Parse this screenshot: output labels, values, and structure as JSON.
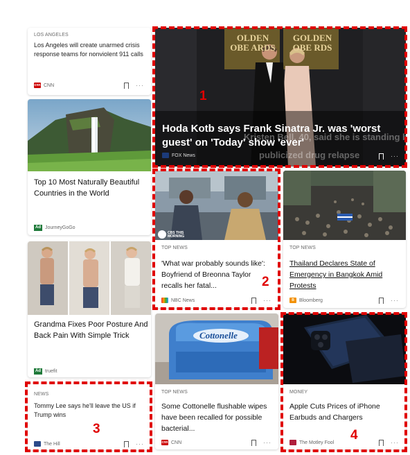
{
  "cards": {
    "la": {
      "category": "LOS ANGELES",
      "title": "Los Angeles will create unarmed crisis response teams for nonviolent 911 calls",
      "source": "CNN"
    },
    "countries": {
      "title": "Top 10 Most Naturally Beautiful Countries in the World",
      "ad_label": "Ad",
      "source": "JourneyGoGo"
    },
    "hero": {
      "title": "Hoda Kotb says Frank Sinatra Jr. was 'worst guest' on 'Today' show 'ever'",
      "source": "FOX News",
      "bg_text_1": "Kristen Bell, 40, said she is standing by",
      "bg_text_2": "publicized drug relapse",
      "sign_left": "OLDEN OBE ARDS",
      "sign_right": "GOLDEN OBE RDS"
    },
    "breonna": {
      "category": "TOP NEWS",
      "title": "'What war probably sounds like': Boyfriend of Breonna Taylor recalls her fatal...",
      "source": "NBC News",
      "tv_logo": "CBS THIS MORNING"
    },
    "thailand": {
      "category": "TOP NEWS",
      "title": "Thailand Declares State of Emergency in Bangkok Amid Protests",
      "source": "Bloomberg"
    },
    "grandma": {
      "title": "Grandma Fixes Poor Posture And Back Pain With Simple Trick",
      "ad_label": "Ad",
      "source": "truefit"
    },
    "cottonelle": {
      "category": "TOP NEWS",
      "title": "Some Cottonelle flushable wipes have been recalled for possible bacterial...",
      "source": "CNN",
      "brand": "Cottonelle"
    },
    "tommy": {
      "category": "NEWS",
      "title": "Tommy Lee says he'll leave the US if Trump wins",
      "source": "The Hill"
    },
    "apple": {
      "category": "MONEY",
      "title": "Apple Cuts Prices of iPhone Earbuds and Chargers",
      "source": "The Motley Fool"
    }
  },
  "annotations": [
    "1",
    "2",
    "3",
    "4"
  ],
  "colors": {
    "annotation_red": "#e00000",
    "ad_green": "#1f7a3a",
    "cnn_red": "#cc0000",
    "bloomberg_orange": "#f29100"
  }
}
